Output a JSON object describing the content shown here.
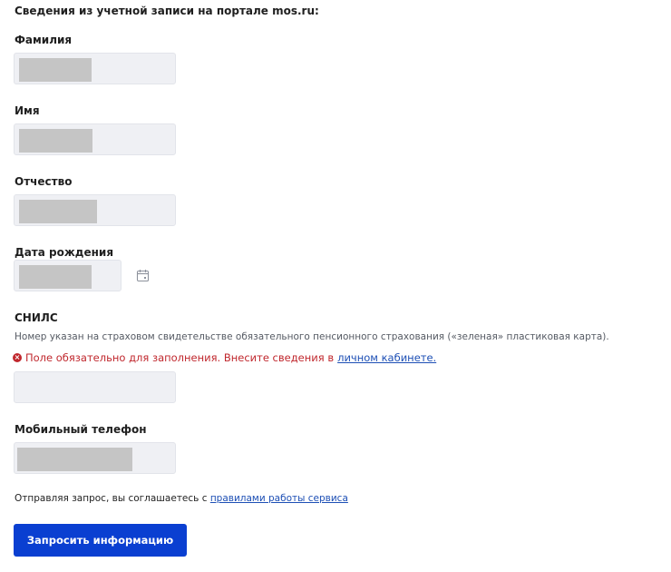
{
  "form": {
    "section_title": "Сведения из учетной записи на портале mos.ru:",
    "fields": {
      "last_name": {
        "label": "Фамилия",
        "value": ""
      },
      "first_name": {
        "label": "Имя",
        "value": ""
      },
      "patronymic": {
        "label": "Отчество",
        "value": ""
      },
      "birth_date": {
        "label": "Дата рождения",
        "value": "",
        "icon": "calendar-icon"
      },
      "snils": {
        "label": "СНИЛС",
        "hint": "Номер указан на страховом свидетельстве обязательного пенсионного страхования («зеленая» пластиковая карта).",
        "error_text": "Поле обязательно для заполнения. Внесите сведения в ",
        "error_link": "личном кабинете.",
        "error_icon": "error-circle-icon",
        "value": ""
      },
      "phone": {
        "label": "Мобильный телефон",
        "value": ""
      }
    },
    "agreement_text": "Отправляя запрос, вы соглашаетесь с ",
    "agreement_link": "правилами работы сервиса",
    "submit_label": "Запросить информацию"
  },
  "colors": {
    "primary_button": "#0a3fd1",
    "error": "#c0272d",
    "link": "#1d4fb5",
    "field_bg": "#eff0f4"
  }
}
